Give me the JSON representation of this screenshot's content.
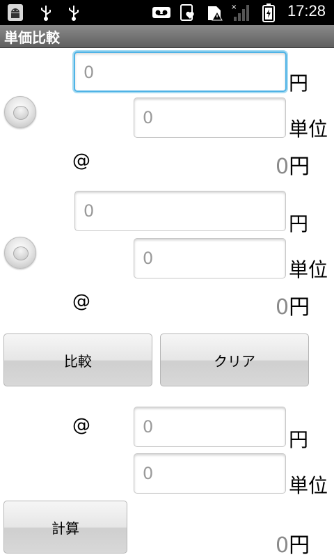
{
  "status_bar": {
    "time": "17:28",
    "icons": [
      "android-debug-icon",
      "usb-icon",
      "usb-icon",
      "voicemail-icon",
      "favorite-icon",
      "sd-warning-icon",
      "signal-icon",
      "battery-icon"
    ]
  },
  "title_bar": {
    "title": "単価比較"
  },
  "item1": {
    "price_value": "0",
    "unit_value": "0",
    "price_unit": "円",
    "count_unit": "単位",
    "at": "@",
    "result_num": "0",
    "result_unit": "円"
  },
  "item2": {
    "price_value": "0",
    "unit_value": "0",
    "price_unit": "円",
    "count_unit": "単位",
    "at": "@",
    "result_num": "0",
    "result_unit": "円"
  },
  "buttons": {
    "compare": "比較",
    "clear": "クリア",
    "calc": "計算"
  },
  "calc": {
    "at": "@",
    "price_value": "0",
    "unit_value": "0",
    "price_unit": "円",
    "count_unit": "単位",
    "result_num": "0",
    "result_unit": "円"
  }
}
